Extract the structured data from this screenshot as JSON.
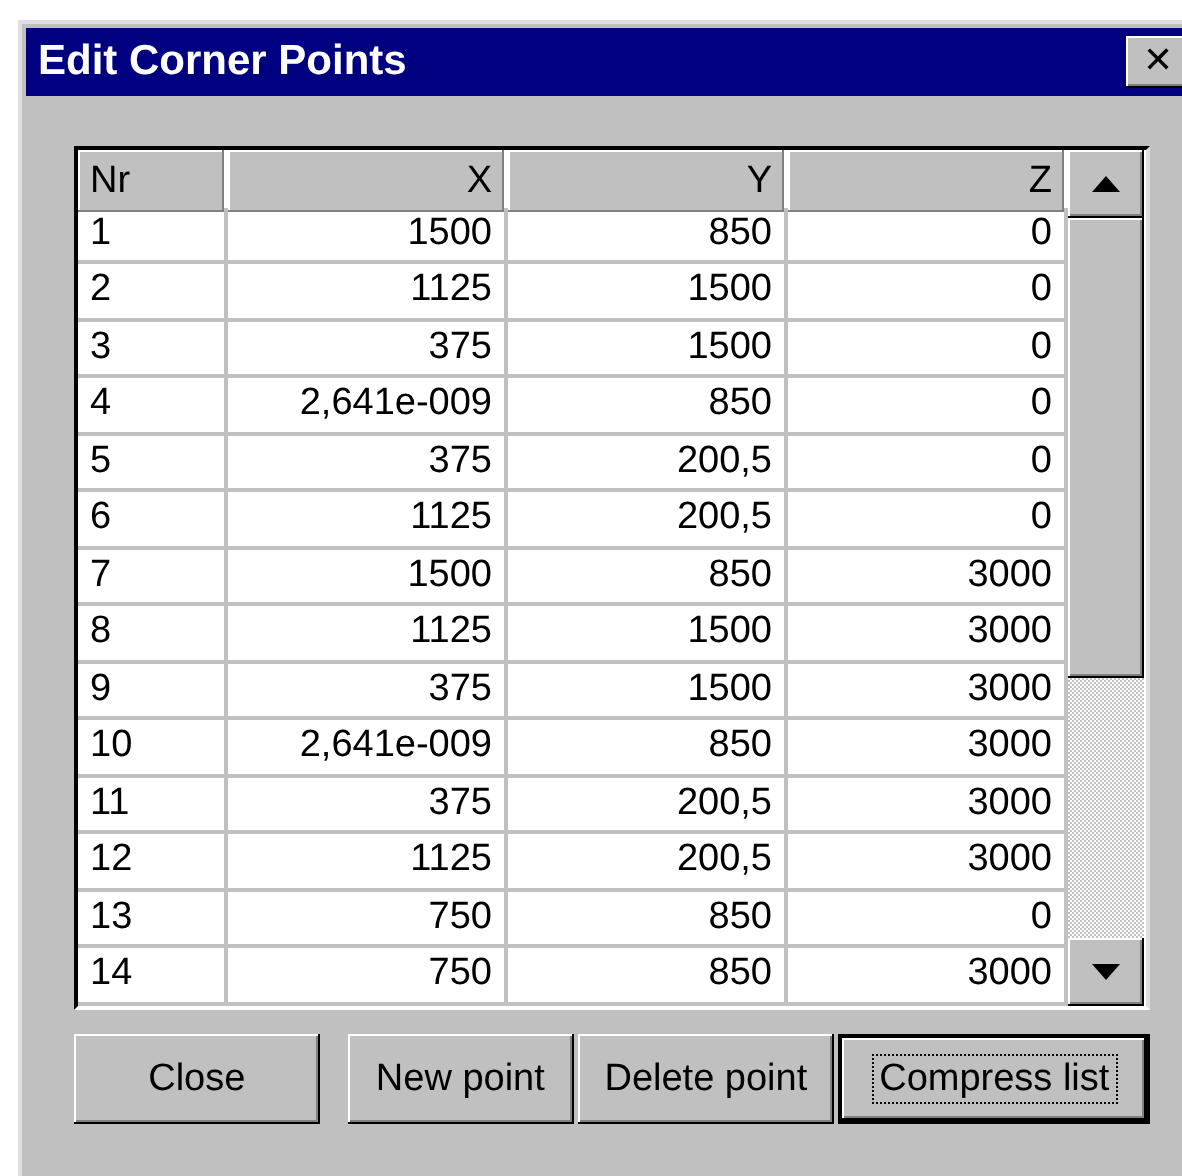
{
  "window": {
    "title": "Edit Corner Points",
    "close_glyph": "✕"
  },
  "table": {
    "columns": [
      "Nr",
      "X",
      "Y",
      "Z"
    ],
    "rows": [
      [
        "1",
        "1500",
        "850",
        "0"
      ],
      [
        "2",
        "1125",
        "1500",
        "0"
      ],
      [
        "3",
        "375",
        "1500",
        "0"
      ],
      [
        "4",
        "2,641e-009",
        "850",
        "0"
      ],
      [
        "5",
        "375",
        "200,5",
        "0"
      ],
      [
        "6",
        "1125",
        "200,5",
        "0"
      ],
      [
        "7",
        "1500",
        "850",
        "3000"
      ],
      [
        "8",
        "1125",
        "1500",
        "3000"
      ],
      [
        "9",
        "375",
        "1500",
        "3000"
      ],
      [
        "10",
        "2,641e-009",
        "850",
        "3000"
      ],
      [
        "11",
        "375",
        "200,5",
        "3000"
      ],
      [
        "12",
        "1125",
        "200,5",
        "3000"
      ],
      [
        "13",
        "750",
        "850",
        "0"
      ],
      [
        "14",
        "750",
        "850",
        "3000"
      ]
    ]
  },
  "buttons": [
    {
      "label": "Close",
      "focused": false
    },
    {
      "label": "New point",
      "focused": false
    },
    {
      "label": "Delete point",
      "focused": false
    },
    {
      "label": "Compress list",
      "focused": true
    }
  ]
}
